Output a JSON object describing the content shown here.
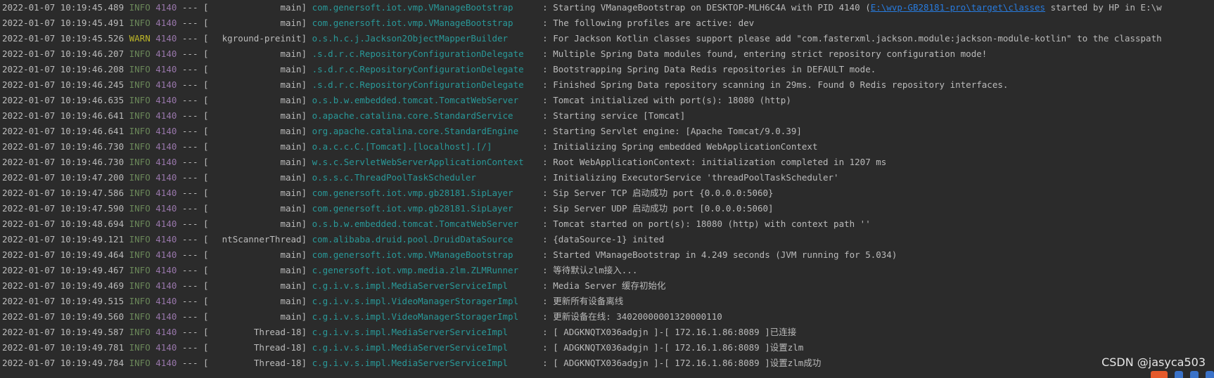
{
  "log_lines": [
    {
      "ts": "2022-01-07 10:19:45.489",
      "level": "INFO",
      "pid": "4140",
      "sep": "---",
      "thread": "main",
      "logger": "com.genersoft.iot.vmp.VManageBootstrap",
      "msg_pre": "Starting VManageBootstrap on DESKTOP-MLH6C4A with PID 4140 (",
      "link": "E:\\wvp-GB28181-pro\\target\\classes",
      "msg_post": " started by HP in E:\\w"
    },
    {
      "ts": "2022-01-07 10:19:45.491",
      "level": "INFO",
      "pid": "4140",
      "sep": "---",
      "thread": "main",
      "logger": "com.genersoft.iot.vmp.VManageBootstrap",
      "msg_pre": "The following profiles are active: dev",
      "link": "",
      "msg_post": ""
    },
    {
      "ts": "2022-01-07 10:19:45.526",
      "level": "WARN",
      "pid": "4140",
      "sep": "---",
      "thread": "kground-preinit",
      "logger": "o.s.h.c.j.Jackson2ObjectMapperBuilder",
      "msg_pre": "For Jackson Kotlin classes support please add \"com.fasterxml.jackson.module:jackson-module-kotlin\" to the classpath",
      "link": "",
      "msg_post": ""
    },
    {
      "ts": "2022-01-07 10:19:46.207",
      "level": "INFO",
      "pid": "4140",
      "sep": "---",
      "thread": "main",
      "logger": ".s.d.r.c.RepositoryConfigurationDelegate",
      "msg_pre": "Multiple Spring Data modules found, entering strict repository configuration mode!",
      "link": "",
      "msg_post": ""
    },
    {
      "ts": "2022-01-07 10:19:46.208",
      "level": "INFO",
      "pid": "4140",
      "sep": "---",
      "thread": "main",
      "logger": ".s.d.r.c.RepositoryConfigurationDelegate",
      "msg_pre": "Bootstrapping Spring Data Redis repositories in DEFAULT mode.",
      "link": "",
      "msg_post": ""
    },
    {
      "ts": "2022-01-07 10:19:46.245",
      "level": "INFO",
      "pid": "4140",
      "sep": "---",
      "thread": "main",
      "logger": ".s.d.r.c.RepositoryConfigurationDelegate",
      "msg_pre": "Finished Spring Data repository scanning in 29ms. Found 0 Redis repository interfaces.",
      "link": "",
      "msg_post": ""
    },
    {
      "ts": "2022-01-07 10:19:46.635",
      "level": "INFO",
      "pid": "4140",
      "sep": "---",
      "thread": "main",
      "logger": "o.s.b.w.embedded.tomcat.TomcatWebServer",
      "msg_pre": "Tomcat initialized with port(s): 18080 (http)",
      "link": "",
      "msg_post": ""
    },
    {
      "ts": "2022-01-07 10:19:46.641",
      "level": "INFO",
      "pid": "4140",
      "sep": "---",
      "thread": "main",
      "logger": "o.apache.catalina.core.StandardService",
      "msg_pre": "Starting service [Tomcat]",
      "link": "",
      "msg_post": ""
    },
    {
      "ts": "2022-01-07 10:19:46.641",
      "level": "INFO",
      "pid": "4140",
      "sep": "---",
      "thread": "main",
      "logger": "org.apache.catalina.core.StandardEngine",
      "msg_pre": "Starting Servlet engine: [Apache Tomcat/9.0.39]",
      "link": "",
      "msg_post": ""
    },
    {
      "ts": "2022-01-07 10:19:46.730",
      "level": "INFO",
      "pid": "4140",
      "sep": "---",
      "thread": "main",
      "logger": "o.a.c.c.C.[Tomcat].[localhost].[/]",
      "msg_pre": "Initializing Spring embedded WebApplicationContext",
      "link": "",
      "msg_post": ""
    },
    {
      "ts": "2022-01-07 10:19:46.730",
      "level": "INFO",
      "pid": "4140",
      "sep": "---",
      "thread": "main",
      "logger": "w.s.c.ServletWebServerApplicationContext",
      "msg_pre": "Root WebApplicationContext: initialization completed in 1207 ms",
      "link": "",
      "msg_post": ""
    },
    {
      "ts": "2022-01-07 10:19:47.200",
      "level": "INFO",
      "pid": "4140",
      "sep": "---",
      "thread": "main",
      "logger": "o.s.s.c.ThreadPoolTaskScheduler",
      "msg_pre": "Initializing ExecutorService 'threadPoolTaskScheduler'",
      "link": "",
      "msg_post": ""
    },
    {
      "ts": "2022-01-07 10:19:47.586",
      "level": "INFO",
      "pid": "4140",
      "sep": "---",
      "thread": "main",
      "logger": "com.genersoft.iot.vmp.gb28181.SipLayer",
      "msg_pre": "Sip Server TCP 启动成功 port {0.0.0.0:5060}",
      "link": "",
      "msg_post": ""
    },
    {
      "ts": "2022-01-07 10:19:47.590",
      "level": "INFO",
      "pid": "4140",
      "sep": "---",
      "thread": "main",
      "logger": "com.genersoft.iot.vmp.gb28181.SipLayer",
      "msg_pre": "Sip Server UDP 启动成功 port [0.0.0.0:5060]",
      "link": "",
      "msg_post": ""
    },
    {
      "ts": "2022-01-07 10:19:48.694",
      "level": "INFO",
      "pid": "4140",
      "sep": "---",
      "thread": "main",
      "logger": "o.s.b.w.embedded.tomcat.TomcatWebServer",
      "msg_pre": "Tomcat started on port(s): 18080 (http) with context path ''",
      "link": "",
      "msg_post": ""
    },
    {
      "ts": "2022-01-07 10:19:49.121",
      "level": "INFO",
      "pid": "4140",
      "sep": "---",
      "thread": "ntScannerThread",
      "logger": "com.alibaba.druid.pool.DruidDataSource",
      "msg_pre": "{dataSource-1} inited",
      "link": "",
      "msg_post": ""
    },
    {
      "ts": "2022-01-07 10:19:49.464",
      "level": "INFO",
      "pid": "4140",
      "sep": "---",
      "thread": "main",
      "logger": "com.genersoft.iot.vmp.VManageBootstrap",
      "msg_pre": "Started VManageBootstrap in 4.249 seconds (JVM running for 5.034)",
      "link": "",
      "msg_post": ""
    },
    {
      "ts": "2022-01-07 10:19:49.467",
      "level": "INFO",
      "pid": "4140",
      "sep": "---",
      "thread": "main",
      "logger": "c.genersoft.iot.vmp.media.zlm.ZLMRunner",
      "msg_pre": "等待默认zlm接入...",
      "link": "",
      "msg_post": ""
    },
    {
      "ts": "2022-01-07 10:19:49.469",
      "level": "INFO",
      "pid": "4140",
      "sep": "---",
      "thread": "main",
      "logger": "c.g.i.v.s.impl.MediaServerServiceImpl",
      "msg_pre": "Media Server 缓存初始化",
      "link": "",
      "msg_post": ""
    },
    {
      "ts": "2022-01-07 10:19:49.515",
      "level": "INFO",
      "pid": "4140",
      "sep": "---",
      "thread": "main",
      "logger": "c.g.i.v.s.impl.VideoManagerStoragerImpl",
      "msg_pre": "更新所有设备离线",
      "link": "",
      "msg_post": ""
    },
    {
      "ts": "2022-01-07 10:19:49.560",
      "level": "INFO",
      "pid": "4140",
      "sep": "---",
      "thread": "main",
      "logger": "c.g.i.v.s.impl.VideoManagerStoragerImpl",
      "msg_pre": "更新设备在线: 34020000001320000110",
      "link": "",
      "msg_post": ""
    },
    {
      "ts": "2022-01-07 10:19:49.587",
      "level": "INFO",
      "pid": "4140",
      "sep": "---",
      "thread": "Thread-18",
      "logger": "c.g.i.v.s.impl.MediaServerServiceImpl",
      "msg_pre": "[ ADGKNQTX036adgjn ]-[ 172.16.1.86:8089 ]已连接",
      "link": "",
      "msg_post": ""
    },
    {
      "ts": "2022-01-07 10:19:49.781",
      "level": "INFO",
      "pid": "4140",
      "sep": "---",
      "thread": "Thread-18",
      "logger": "c.g.i.v.s.impl.MediaServerServiceImpl",
      "msg_pre": "[ ADGKNQTX036adgjn ]-[ 172.16.1.86:8089 ]设置zlm",
      "link": "",
      "msg_post": ""
    },
    {
      "ts": "2022-01-07 10:19:49.784",
      "level": "INFO",
      "pid": "4140",
      "sep": "---",
      "thread": "Thread-18",
      "logger": "c.g.i.v.s.impl.MediaServerServiceImpl",
      "msg_pre": "[ ADGKNQTX036adgjn ]-[ 172.16.1.86:8089 ]设置zlm成功",
      "link": "",
      "msg_post": ""
    }
  ],
  "watermark": "CSDN @jasyca503",
  "colors": {
    "background": "#2b2b2b",
    "text": "#bbbbbb",
    "info": "#6a8759",
    "warn": "#bbb529",
    "pid": "#9876aa",
    "logger": "#299999",
    "link": "#287bde"
  }
}
